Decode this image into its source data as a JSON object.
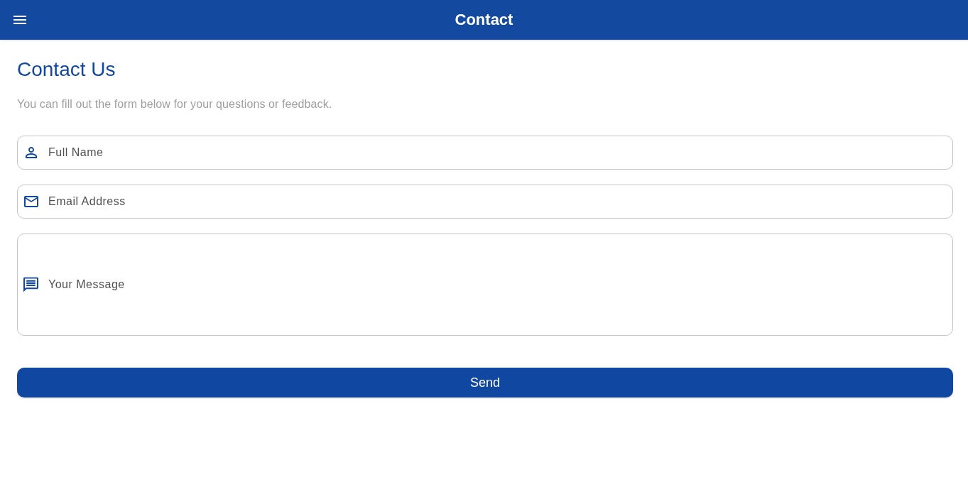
{
  "app_bar": {
    "title": "Contact"
  },
  "page": {
    "heading": "Contact Us",
    "subtitle": "You can fill out the form below for your questions or feedback."
  },
  "fields": [
    {
      "kind": "name",
      "placeholder": "Full Name"
    },
    {
      "kind": "email",
      "placeholder": "Email Address"
    },
    {
      "kind": "message",
      "placeholder": "Your Message"
    }
  ],
  "submit_button": {
    "label": "Send"
  }
}
